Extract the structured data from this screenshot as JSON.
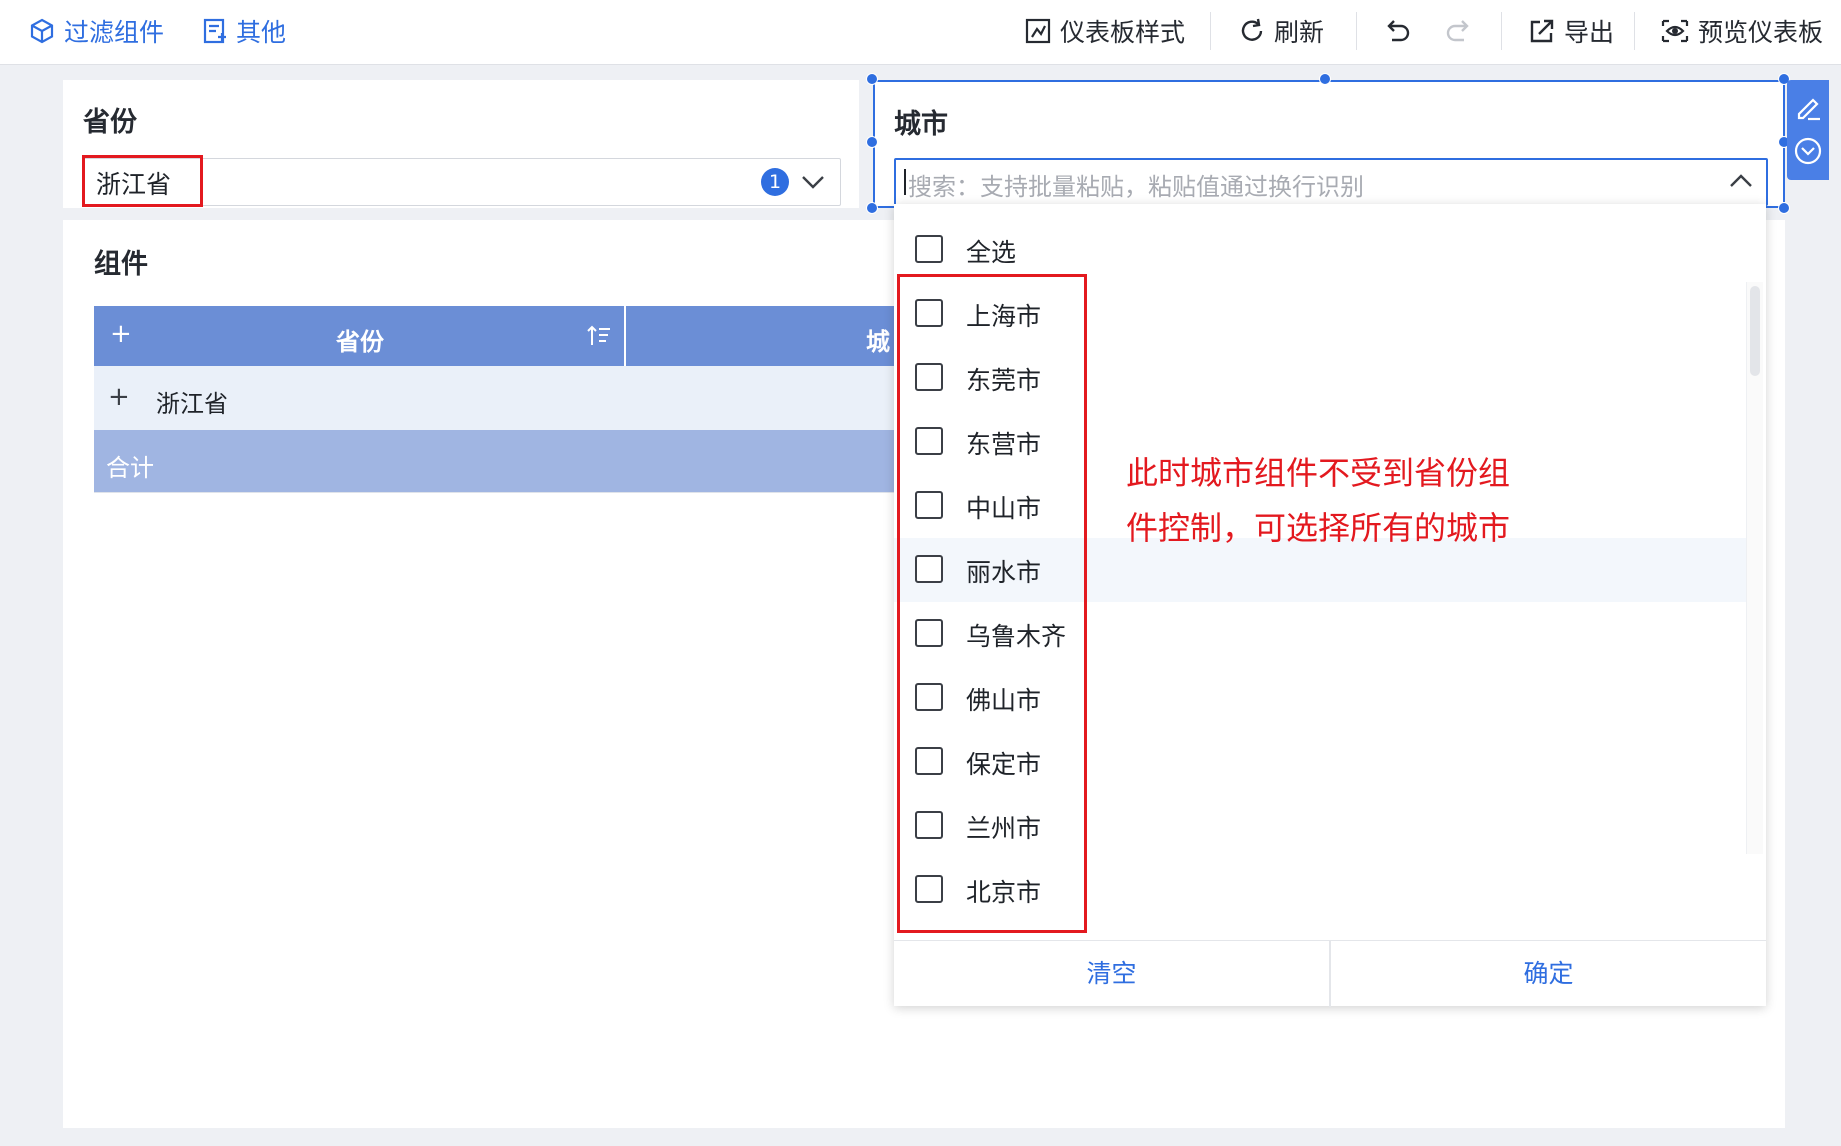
{
  "toolbar": {
    "filter_component": "过滤组件",
    "other": "其他",
    "dashboard_style": "仪表板样式",
    "refresh": "刷新",
    "export": "导出",
    "preview_dashboard": "预览仪表板"
  },
  "province_filter": {
    "title": "省份",
    "selected_value": "浙江省",
    "selected_count": "1"
  },
  "city_filter": {
    "title": "城市",
    "search_placeholder": "搜索：支持批量粘贴，粘贴值通过换行识别"
  },
  "component_panel": {
    "title": "组件",
    "table": {
      "add_symbol": "+",
      "columns": [
        "省份",
        "城"
      ],
      "rows": [
        {
          "expand": "+",
          "province": "浙江省"
        }
      ],
      "total_label": "合计"
    }
  },
  "city_dropdown": {
    "select_all": "全选",
    "options": [
      "上海市",
      "东莞市",
      "东营市",
      "中山市",
      "丽水市",
      "乌鲁木齐",
      "佛山市",
      "保定市",
      "兰州市",
      "北京市"
    ],
    "hovered_index": 4,
    "clear_label": "清空",
    "confirm_label": "确定"
  },
  "annotation": {
    "line1": "此时城市组件不受到省份组",
    "line2": "件控制，可选择所有的城市"
  },
  "colors": {
    "accent": "#2f6ee0",
    "table_header": "#6b8ed6",
    "total_row": "#a0b5e2",
    "annotation": "#e3191f"
  }
}
